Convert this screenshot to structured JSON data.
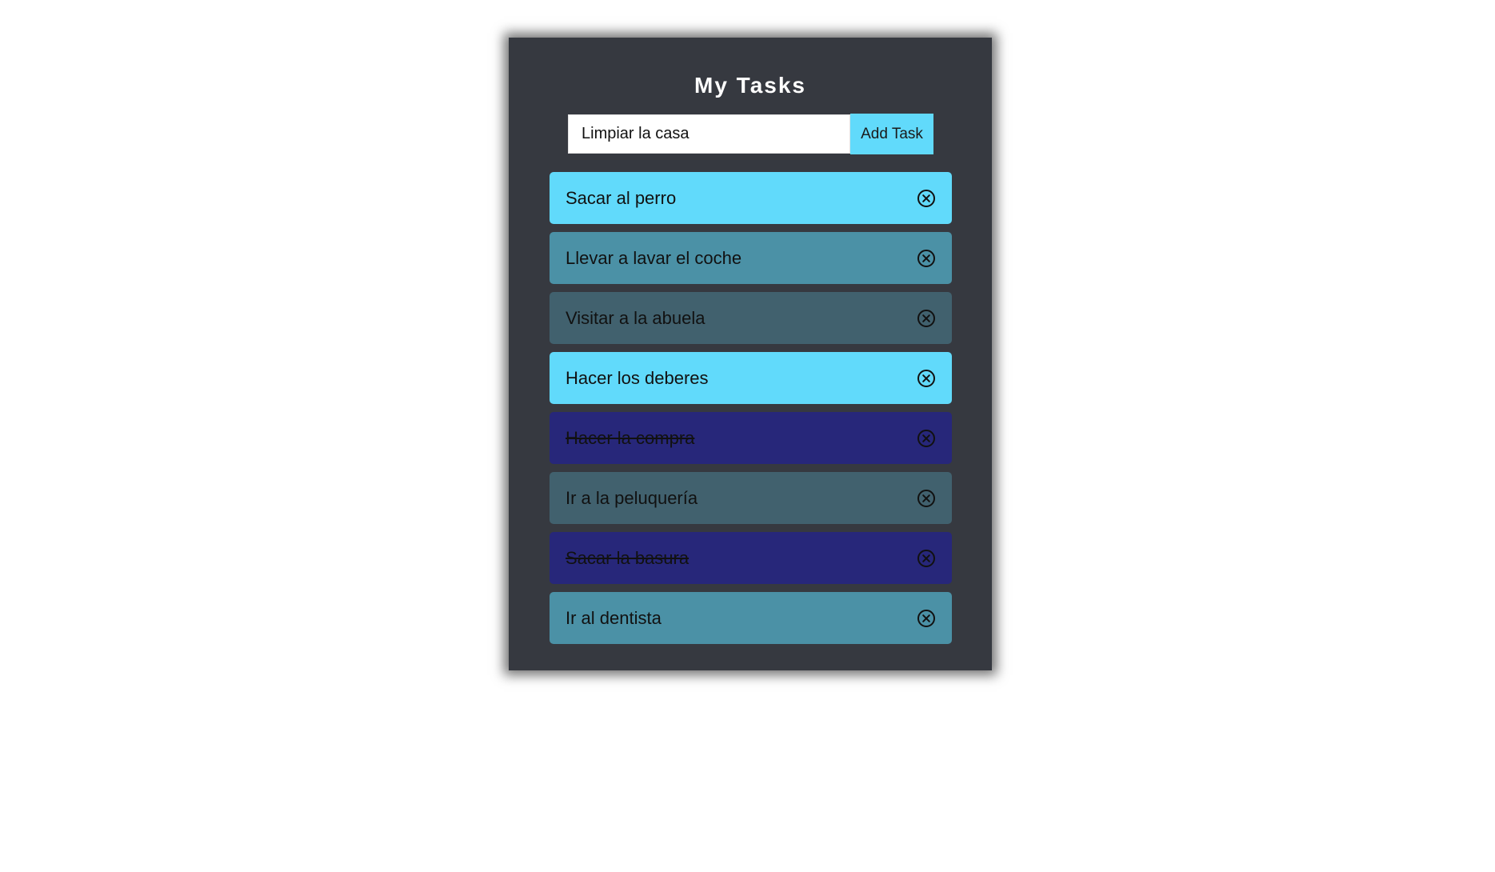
{
  "app": {
    "title": "My Tasks"
  },
  "form": {
    "input_value": "Limpiar la casa",
    "add_label": "Add Task"
  },
  "tasks": [
    {
      "label": "Sacar al perro",
      "completed": false,
      "color": "#61dafb"
    },
    {
      "label": "Llevar a lavar el coche",
      "completed": false,
      "color": "#4b91a6"
    },
    {
      "label": "Visitar a la abuela",
      "completed": false,
      "color": "#41616e"
    },
    {
      "label": "Hacer los deberes",
      "completed": false,
      "color": "#61dafb"
    },
    {
      "label": "Hacer la compra",
      "completed": true,
      "color": "#27277a"
    },
    {
      "label": "Ir a la peluquería",
      "completed": false,
      "color": "#41616e"
    },
    {
      "label": "Sacar la basura",
      "completed": true,
      "color": "#27277a"
    },
    {
      "label": "Ir al dentista",
      "completed": false,
      "color": "#4b91a6"
    }
  ],
  "icons": {
    "delete": "close-circle-icon"
  }
}
